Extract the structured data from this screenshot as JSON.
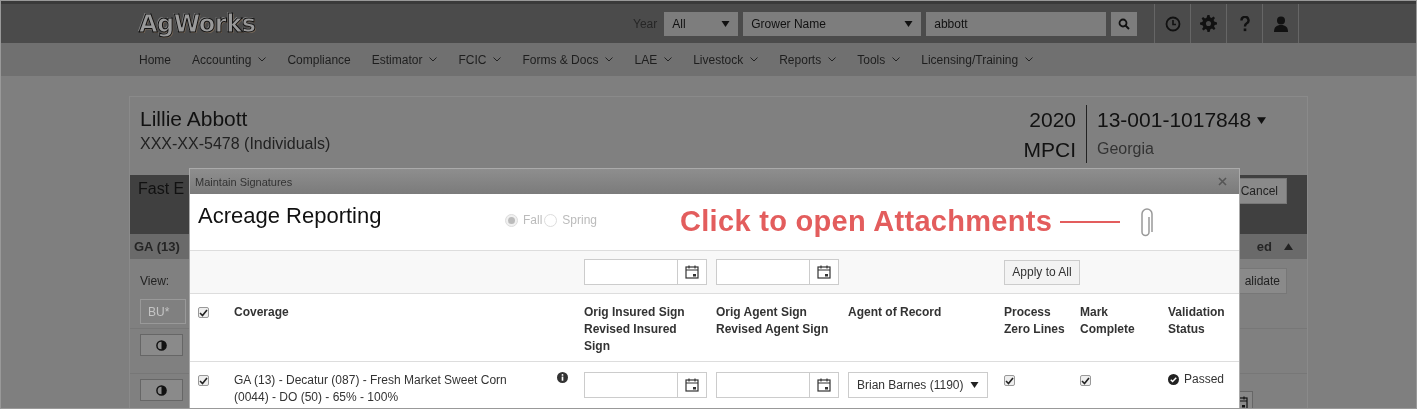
{
  "header": {
    "logo": "AgWorks",
    "year_label": "Year",
    "year_value": "All",
    "grower_field": "Grower Name",
    "search_value": "abbott"
  },
  "nav": [
    {
      "label": "Home",
      "has_menu": false
    },
    {
      "label": "Accounting",
      "has_menu": true
    },
    {
      "label": "Compliance",
      "has_menu": false
    },
    {
      "label": "Estimator",
      "has_menu": true
    },
    {
      "label": "FCIC",
      "has_menu": true
    },
    {
      "label": "Forms & Docs",
      "has_menu": true
    },
    {
      "label": "LAE",
      "has_menu": true
    },
    {
      "label": "Livestock",
      "has_menu": true
    },
    {
      "label": "Reports",
      "has_menu": true
    },
    {
      "label": "Tools",
      "has_menu": true
    },
    {
      "label": "Licensing/Training",
      "has_menu": true
    }
  ],
  "policy": {
    "name": "Lillie Abbott",
    "id": "XXX-XX-5478 (Individuals)",
    "year": "2020",
    "plan": "MPCI",
    "policy_number": "13-001-1017848",
    "state": "Georgia"
  },
  "background": {
    "band_title": "Fast E",
    "cancel": "Cancel",
    "section": "GA (13)",
    "section_right": "ed",
    "view_label": "View:",
    "validate": "alidate",
    "bu_placeholder": "BU*"
  },
  "modal": {
    "title": "Maintain Signatures",
    "heading": "Acreage Reporting",
    "seasons": [
      {
        "label": "Fall",
        "selected": true
      },
      {
        "label": "Spring",
        "selected": false
      }
    ],
    "annotation": "Click to open Attachments",
    "apply_button": "Apply to All",
    "select_all_checked": true,
    "columns": [
      "Coverage",
      "Orig Insured Sign Revised Insured Sign",
      "Orig Agent Sign Revised Agent Sign",
      "Agent of Record",
      "Process Zero Lines",
      "Mark Complete",
      "Validation Status"
    ],
    "rows": [
      {
        "checked": true,
        "coverage": "GA (13) - Decatur (087) - Fresh Market Sweet Corn (0044) - DO (50) - 65% - 100%",
        "agent": "Brian Barnes (1190)",
        "process_zero": true,
        "mark_complete": true,
        "status": "Passed"
      }
    ]
  }
}
